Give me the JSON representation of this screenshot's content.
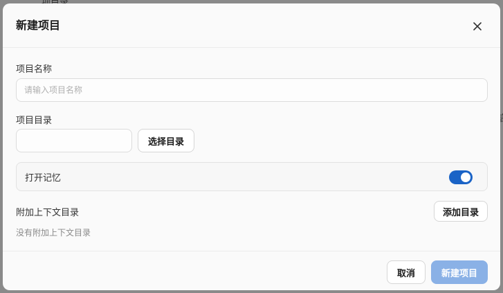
{
  "backdrop": {
    "top_text": "项目录",
    "right_text": "启"
  },
  "dialog": {
    "title": "新建项目",
    "close_icon": "close-icon",
    "project_name": {
      "label": "项目名称",
      "placeholder": "请输入项目名称",
      "value": ""
    },
    "project_dir": {
      "label": "项目目录",
      "value": "",
      "choose_button": "选择目录"
    },
    "memory": {
      "label": "打开记忆",
      "enabled": true,
      "accent_color": "#1a63c6"
    },
    "context_dirs": {
      "label": "附加上下文目录",
      "add_button": "添加目录",
      "empty_text": "没有附加上下文目录"
    },
    "footer": {
      "cancel_button": "取消",
      "create_button": "新建项目",
      "create_button_color": "#8ab1e6"
    }
  }
}
